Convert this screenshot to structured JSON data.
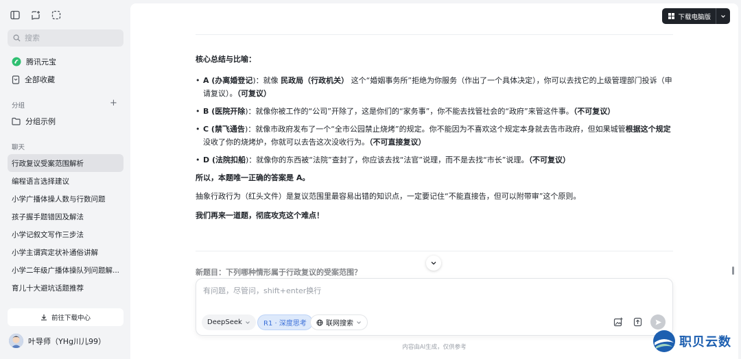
{
  "sidebar": {
    "search_placeholder": "搜索",
    "nav": [
      {
        "label": "腾讯元宝",
        "icon": "yuanbao-logo-icon"
      },
      {
        "label": "全部收藏",
        "icon": "bookmark-icon"
      }
    ],
    "group_section": "分组",
    "groups": [
      {
        "label": "分组示例",
        "icon": "folder-icon"
      }
    ],
    "chat_section": "聊天",
    "chats": [
      "行政复议受案范围解析",
      "编程语言选择建议",
      "小学广播体操人数与行数问题",
      "孩子握手题错因及解法",
      "小学记叙文写作三步法",
      "小学主谓宾定状补通俗讲解",
      "小学二年级广播体操队列问题解...",
      "育儿十大避坑话题推荐"
    ],
    "download_center": "前往下载中心",
    "user_name": "叶导师（YHg川儿99）"
  },
  "header": {
    "download_desktop": "下载电脑版"
  },
  "content": {
    "heading": "核心总结与比喻：",
    "items": [
      {
        "letter": "A (",
        "tag": "办离婚登记",
        "mid": ")：就像 ",
        "bold1": "民政局（行政机关）",
        "text": " 这个“婚姻事务所”拒绝为你服务（作出了一个具体决定），你可以去找它的上级管理部门投诉（申请复议）。",
        "verdict": "（可复议）"
      },
      {
        "letter": "B (",
        "tag": "医院开除",
        "text": ")：就像你被工作的“公司”开除了，这是你们的“家务事”，你不能去找管社会的“政府”来管这件事。",
        "verdict": "（不可复议）"
      },
      {
        "letter": "C (",
        "tag": "禁飞通告",
        "text": ")：就像市政府发布了一个“全市公园禁止烧烤”的规定。你不能因为不喜欢这个规定本身就去告市政府，但如果城管",
        "bold1": "根据这个规定",
        "text2": "没收了你的烧烤炉，你就可以去告这次没收行为。",
        "verdict": "（不可直接复议）"
      },
      {
        "letter": "D (",
        "tag": "法院扣船",
        "text": ")：就像你的东西被“法院”查封了，你应该去找“法官”说理，而不是去找“市长”说理。",
        "verdict": "（不可复议）"
      }
    ],
    "conclusion": "所以，本题唯一正确的答案是 A。",
    "note": "抽象行政行为（红头文件）是复议范围里最容易出错的知识点，一定要记住“不能直接告，但可以附带审”这个原则。",
    "cta": "我们再来一道题，彻底攻克这个难点！",
    "next_question": "新题目：下列哪种情形属于行政复议的受案范围？"
  },
  "composer": {
    "placeholder": "有问题，尽管问，shift+enter换行",
    "model": "DeepSeek",
    "deep_think": "R1 · 深度思考",
    "web_search": "联网搜索"
  },
  "footer": {
    "disclaimer": "内容由AI生成，仅供参考"
  },
  "watermark": "职贝云数",
  "colors": {
    "accent": "#3a6fd8",
    "dark_button": "#1f2329",
    "sidebar_bg": "#f3f4f6"
  }
}
